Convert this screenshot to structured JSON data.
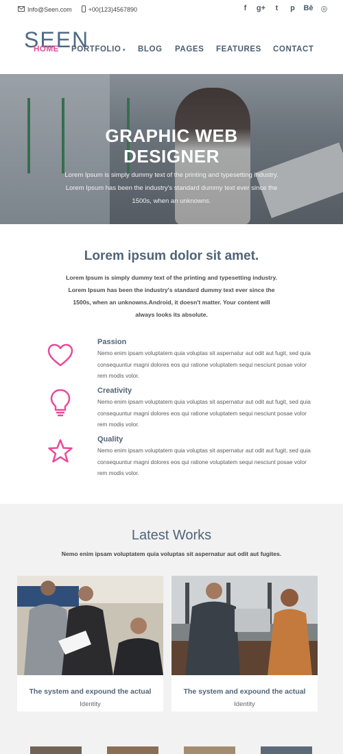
{
  "topbar": {
    "email": "Info@Seen.com",
    "phone": "+00(123)4567890",
    "social": [
      {
        "icon": "facebook-icon",
        "glyph": "f"
      },
      {
        "icon": "google-plus-icon",
        "glyph": "g+"
      },
      {
        "icon": "twitter-icon",
        "glyph": "t"
      },
      {
        "icon": "pinterest-icon",
        "glyph": "p"
      },
      {
        "icon": "behance-icon",
        "glyph": "Bē"
      },
      {
        "icon": "dribbble-icon",
        "glyph": "◎"
      }
    ]
  },
  "header": {
    "logo": "SEEN",
    "nav": [
      {
        "label": "HOME",
        "active": true
      },
      {
        "label": "PORTFOLIO",
        "dropdown": true
      },
      {
        "label": "BLOG"
      },
      {
        "label": "PAGES"
      },
      {
        "label": "FEATURES"
      },
      {
        "label": "CONTACT"
      }
    ]
  },
  "hero": {
    "title_line1": "GRAPHIC WEB",
    "title_line2": "DESIGNER",
    "description": "Lorem Ipsum is simply dummy text of the printing and typesetting industry. Lorem Ipsum has been the industry's standard dummy text ever since the 1500s, when an unknowns."
  },
  "intro": {
    "title": "Lorem ipsum dolor sit amet.",
    "text": "Lorem Ipsum is simply dummy text of the printing and typesetting industry. Lorem Ipsum has been the industry's standard dummy text ever since the 1500s, when an unknowns.Android, it doesn't matter. Your content will always looks its absolute."
  },
  "features": [
    {
      "name": "Passion",
      "icon": "heart-icon",
      "text": "Nemo enim ipsam voluptatem quia voluptas sit aspernatur aut odit aut fugit, sed quia consequuntur magni dolores eos qui ratione voluptatem sequi nesciunt posae volor rem modis volor."
    },
    {
      "name": "Creativity",
      "icon": "lightbulb-icon",
      "text": "Nemo enim ipsam voluptatem quia voluptas sit aspernatur aut odit aut fugit, sed quia consequuntur magni dolores eos qui ratione voluptatem sequi nesciunt posae volor rem modis volor."
    },
    {
      "name": "Quality",
      "icon": "star-icon",
      "text": "Nemo enim ipsam voluptatem quia voluptas sit aspernatur aut odit aut fugit, sed quia consequuntur magni dolores eos qui ratione voluptatem sequi nesciunt posae volor rem modis volor."
    }
  ],
  "works": {
    "title": "Latest Works",
    "subtitle": "Nemo enim ipsam voluptatem quia voluptas sit aspernatur aut odit aut fugites.",
    "cards": [
      {
        "title": "The system and expound the actual",
        "category": "Identity"
      },
      {
        "title": "The system and expound the actual",
        "category": "Identity"
      }
    ]
  },
  "colors": {
    "accent": "#e9499a",
    "heading": "#4f6478",
    "works_bg": "#f2f2f3"
  }
}
